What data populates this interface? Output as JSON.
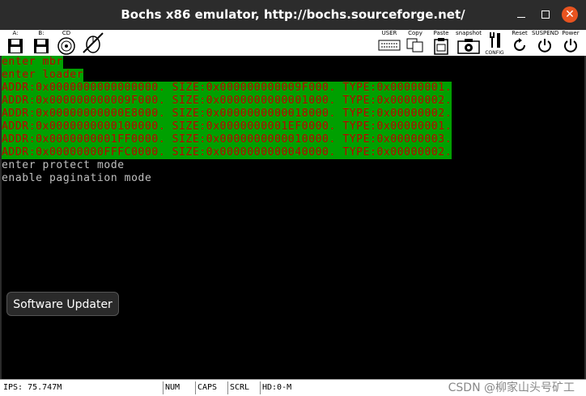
{
  "window": {
    "title": "Bochs x86 emulator, http://bochs.sourceforge.net/",
    "close_glyph": "✕"
  },
  "toolbar": {
    "floppy_a_label": "A:",
    "floppy_b_label": "B:",
    "cd_label": "CD",
    "user_label": "USER",
    "copy_label": "Copy",
    "paste_label": "Paste",
    "snapshot_label": "snapshot",
    "config_label": "CONFIG",
    "reset_label": "Reset",
    "suspend_label": "SUSPEND",
    "power_label": "Power"
  },
  "screen": {
    "lines": [
      {
        "text": "enter mbr",
        "highlight": true
      },
      {
        "text": "enter loader",
        "highlight": true
      },
      {
        "text": "ADDR:0x0000000000000000. SIZE:0x000000000009F000. TYPE:0x00000001.",
        "highlight": true
      },
      {
        "text": "ADDR:0x000000000009F000. SIZE:0x0000000000001000. TYPE:0x00000002.",
        "highlight": true
      },
      {
        "text": "ADDR:0x00000000000E8000. SIZE:0x0000000000018000. TYPE:0x00000002.",
        "highlight": true
      },
      {
        "text": "ADDR:0x0000000000100000. SIZE:0x0000000001EF0000. TYPE:0x00000001.",
        "highlight": true
      },
      {
        "text": "ADDR:0x0000000001FF0000. SIZE:0x0000000000010000. TYPE:0x00000003.",
        "highlight": true
      },
      {
        "text": "ADDR:0x00000000FFFC0000. SIZE:0x0000000000040000. TYPE:0x00000002.",
        "highlight": true
      },
      {
        "text": "enter protect mode",
        "highlight": false
      },
      {
        "text": "enable pagination mode",
        "highlight": false
      }
    ]
  },
  "popup": {
    "label": "Software Updater"
  },
  "statusbar": {
    "ips": "IPS: 75.747M",
    "num": "NUM",
    "caps": "CAPS",
    "scrl": "SCRL",
    "hd": "HD:0-M",
    "watermark": "CSDN @柳家山头号矿工"
  },
  "colors": {
    "highlight_bg": "#00a000",
    "highlight_fg": "#c00000",
    "plain_fg": "#c0c0c0",
    "title_bar": "#2c2c2c",
    "close_button": "#e95420"
  }
}
